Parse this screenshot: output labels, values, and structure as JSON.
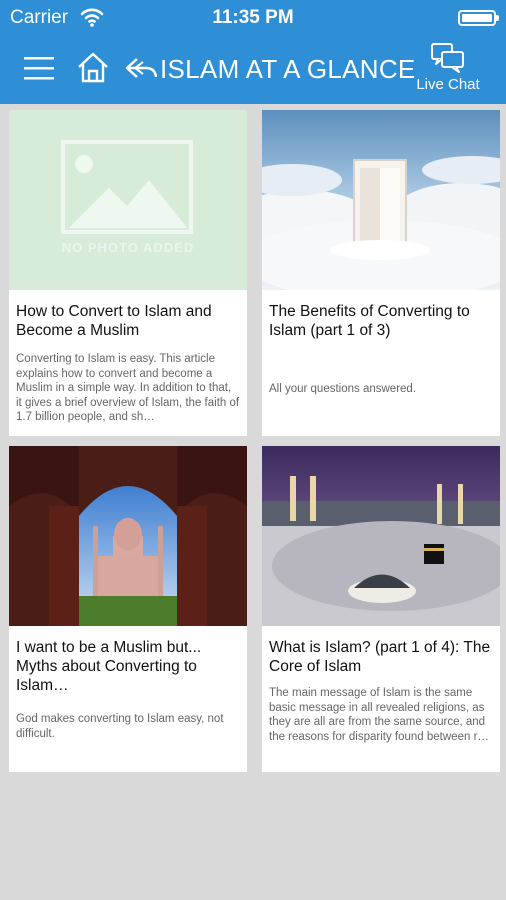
{
  "status_bar": {
    "carrier": "Carrier",
    "time": "11:35 PM"
  },
  "header": {
    "title": "ISLAM AT A GLANCE",
    "live_chat": "Live Chat"
  },
  "icons": {
    "menu": "hamburger-icon",
    "home": "home-icon",
    "back": "back-arrow-icon",
    "chat": "chat-bubbles-icon"
  },
  "colors": {
    "accent": "#2f8fd6",
    "background": "#d9d9d9",
    "card": "#ffffff"
  },
  "articles": [
    {
      "title": "How to Convert to Islam and Become a Muslim",
      "description": "Converting to Islam is easy.  This article explains how to convert and become a Muslim in a simple way.  In addition to that, it gives a brief overview of Islam, the faith of 1.7 billion people, and sh…",
      "image_caption": "NO PHOTO ADDED"
    },
    {
      "title": "The Benefits of Converting to Islam (part 1 of 3)",
      "description": "All your questions answered."
    },
    {
      "title": "I want to be a Muslim but... Myths about Converting to Islam…",
      "description": "God makes converting to Islam easy, not difficult."
    },
    {
      "title": "What is Islam? (part 1 of 4): The Core of Islam",
      "description": "The main message of Islam is the same basic message in all revealed religions, as they are all are from the same source, and the reasons for disparity found between r…"
    }
  ]
}
